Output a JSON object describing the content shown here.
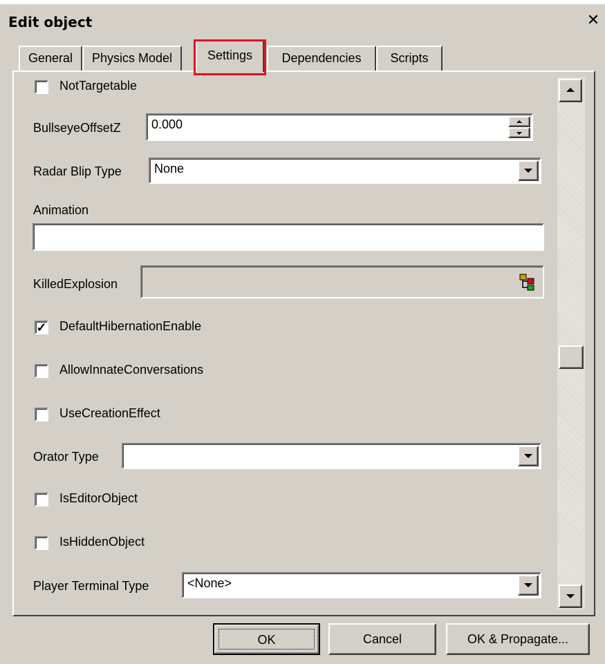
{
  "window": {
    "title": "Edit object",
    "close_glyph": "✕"
  },
  "tabs": [
    {
      "label": "General",
      "active": false
    },
    {
      "label": "Physics Model",
      "active": false
    },
    {
      "label": "Settings",
      "active": true
    },
    {
      "label": "Dependencies",
      "active": false
    },
    {
      "label": "Scripts",
      "active": false
    }
  ],
  "settings": {
    "not_targetable": {
      "label": "NotTargetable",
      "checked": false
    },
    "bullseye_offset_z": {
      "label": "BullseyeOffsetZ",
      "value": "0.000"
    },
    "radar_blip_type": {
      "label": "Radar Blip Type",
      "value": "None"
    },
    "animation": {
      "label": "Animation",
      "value": ""
    },
    "killed_explosion": {
      "label": "KilledExplosion",
      "value": ""
    },
    "default_hibernation_enable": {
      "label": "DefaultHibernationEnable",
      "checked": true
    },
    "allow_innate_conversations": {
      "label": "AllowInnateConversations",
      "checked": false
    },
    "use_creation_effect": {
      "label": "UseCreationEffect",
      "checked": false
    },
    "orator_type": {
      "label": "Orator Type",
      "value": ""
    },
    "is_editor_object": {
      "label": "IsEditorObject",
      "checked": false
    },
    "is_hidden_object": {
      "label": "IsHiddenObject",
      "checked": false
    },
    "player_terminal_type": {
      "label": "Player Terminal Type",
      "value": "<None>"
    }
  },
  "check_glyph": "✓",
  "buttons": {
    "ok": "OK",
    "cancel": "Cancel",
    "ok_propagate": "OK & Propagate..."
  },
  "colors": {
    "dialog_face": "#d4d0c8",
    "highlight_box": "#e0141e"
  }
}
